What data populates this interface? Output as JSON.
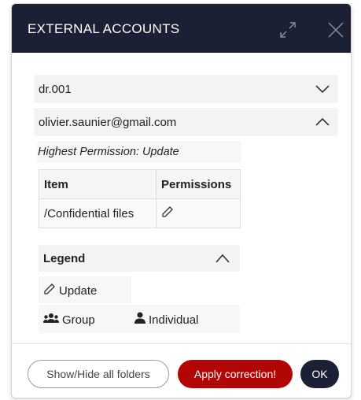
{
  "dialog": {
    "title": "EXTERNAL ACCOUNTS"
  },
  "accounts": [
    {
      "name": "dr.001",
      "expanded": false
    },
    {
      "name": "olivier.saunier@gmail.com",
      "expanded": true
    }
  ],
  "detail": {
    "highest_permission": "Highest Permission: Update",
    "table": {
      "headers": [
        "Item",
        "Permissions"
      ],
      "rows": [
        {
          "item": "/Confidential files",
          "permission_icon": "pencil-icon"
        }
      ]
    }
  },
  "legend": {
    "title": "Legend",
    "items": [
      {
        "icon": "pencil-icon",
        "label": "Update"
      },
      {
        "icon": "group-icon",
        "label": "Group"
      },
      {
        "icon": "person-icon",
        "label": "Individual"
      }
    ]
  },
  "footer": {
    "show_hide_label": "Show/Hide all folders",
    "apply_label": "Apply correction!",
    "ok_label": "OK"
  },
  "colors": {
    "header_bg": "#1c2035",
    "apply_bg": "#b20505",
    "ok_bg": "#1c2035"
  }
}
